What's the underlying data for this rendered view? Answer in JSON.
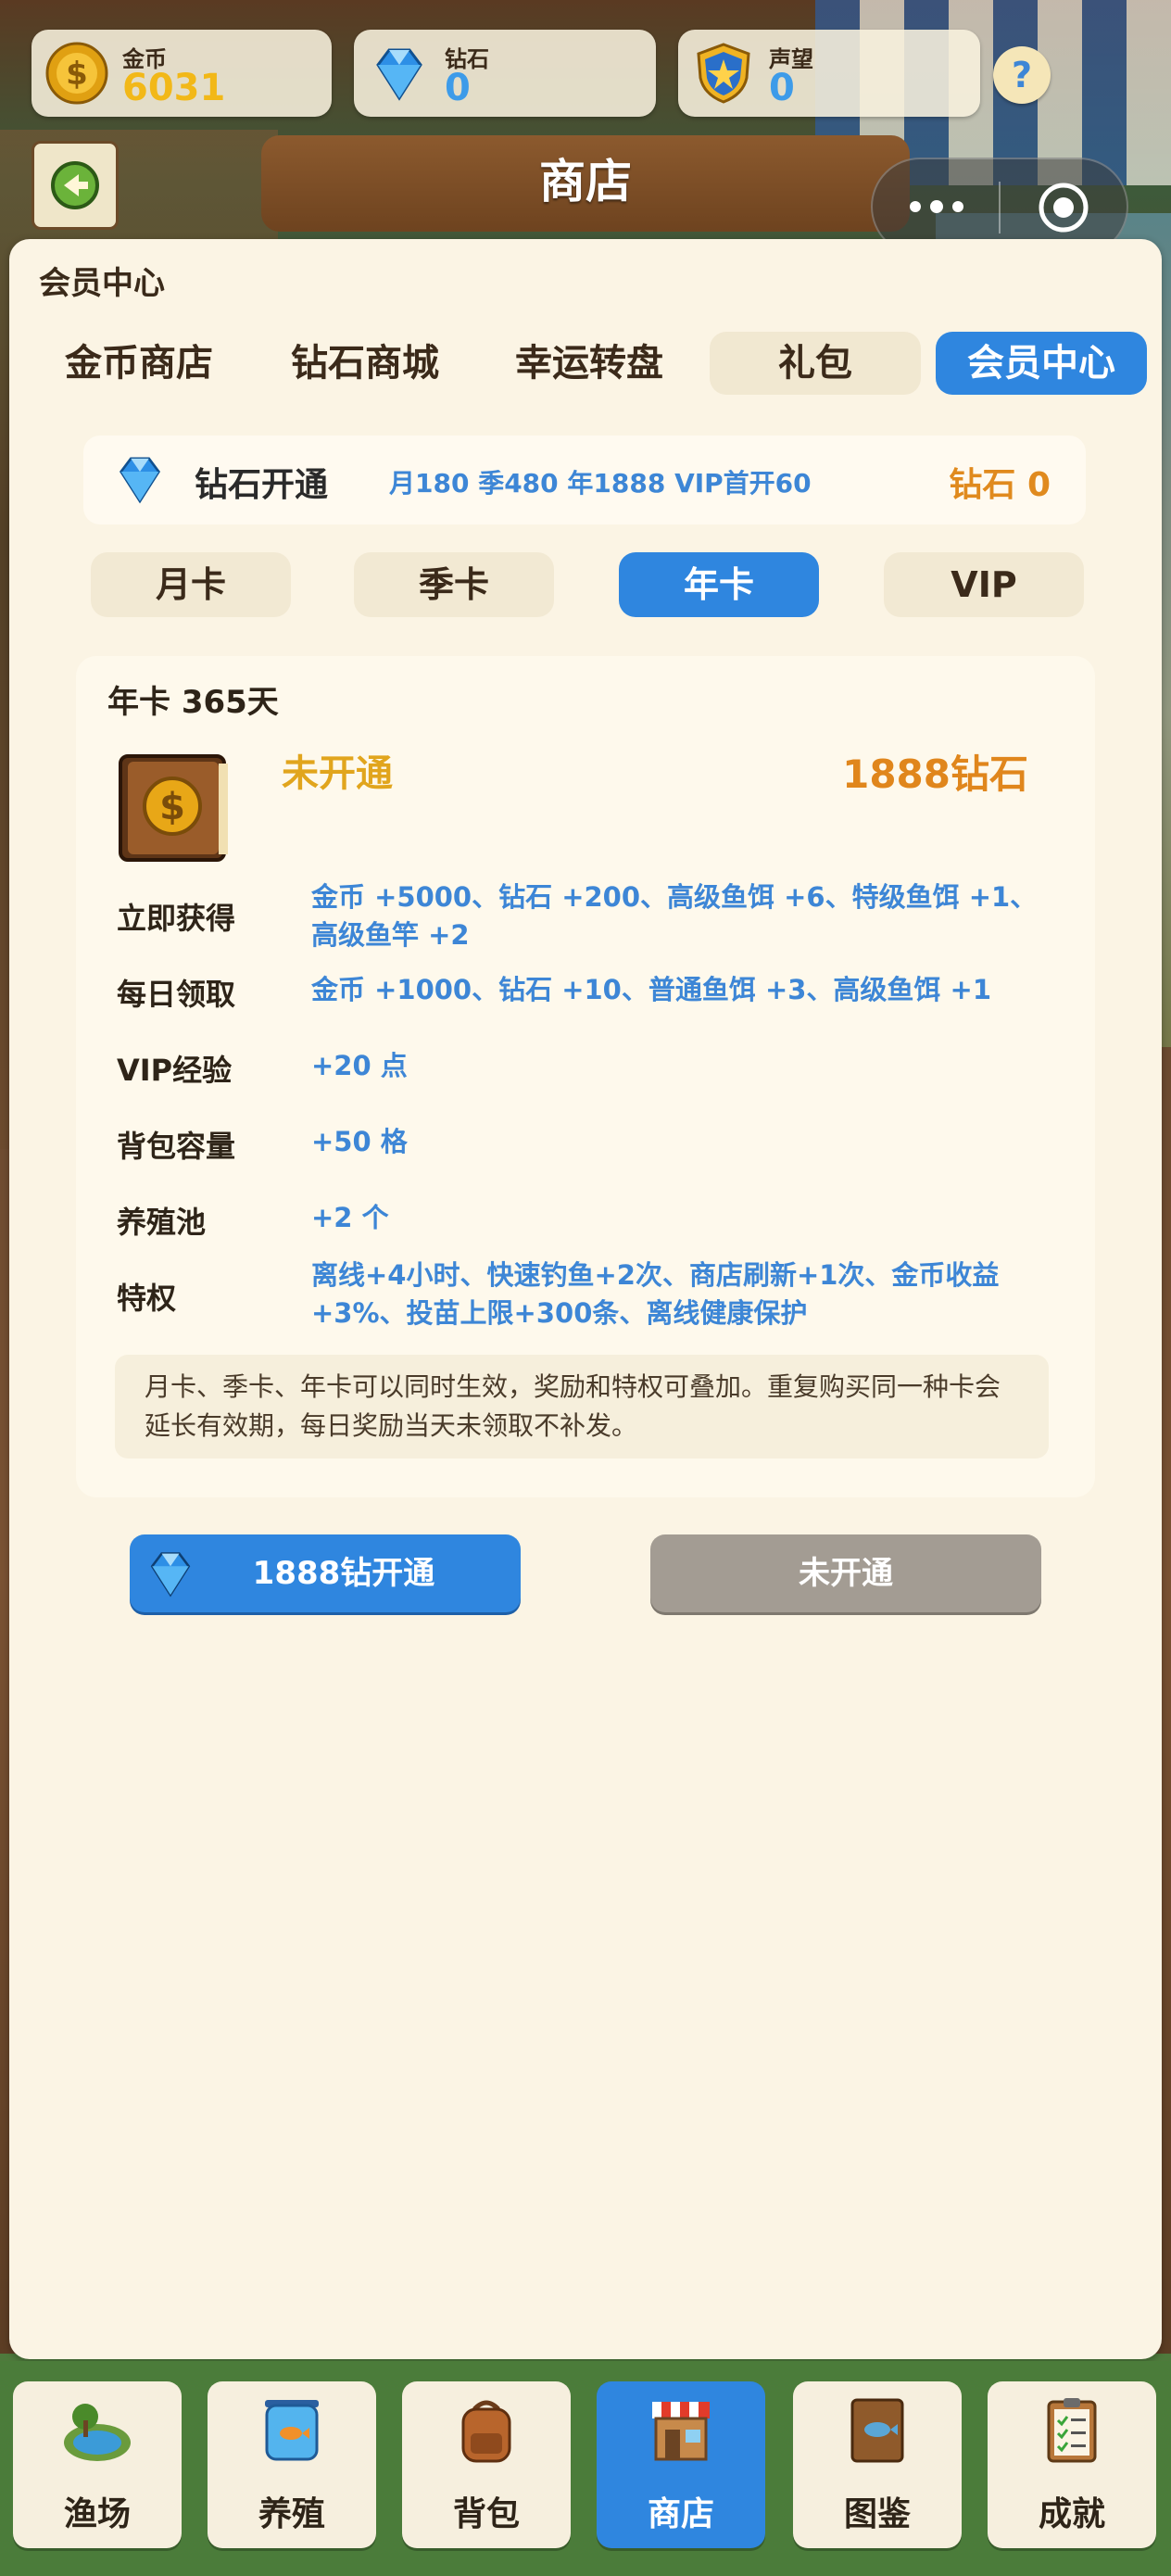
{
  "currencies": {
    "gold": {
      "label": "金币",
      "value": "6031",
      "color": "#f2b818"
    },
    "diamond": {
      "label": "钻石",
      "value": "0",
      "color": "#3d9be9"
    },
    "prestige": {
      "label": "声望",
      "value": "0",
      "color": "#3d9be9"
    }
  },
  "help_label": "?",
  "header": {
    "title": "商店"
  },
  "panel_title": "会员中心",
  "tabs": [
    "金币商店",
    "钻石商城",
    "幸运转盘",
    "礼包",
    "会员中心"
  ],
  "active_tab": "会员中心",
  "vip_bar": {
    "title": "钻石开通",
    "prices": "月180 季480 年1888 VIP首开60",
    "balance": "钻石 0"
  },
  "subtabs": [
    "月卡",
    "季卡",
    "年卡",
    "VIP"
  ],
  "active_subtab": "年卡",
  "card": {
    "title": "年卡 365天",
    "status": "未开通",
    "price": "1888钻石",
    "rows": [
      {
        "label": "立即获得",
        "value": "金币 +5000、钻石 +200、高级鱼饵 +6、特级鱼饵 +1、高级鱼竿 +2"
      },
      {
        "label": "每日领取",
        "value": "金币 +1000、钻石 +10、普通鱼饵 +3、高级鱼饵 +1"
      },
      {
        "label": "VIP经验",
        "value": "+20 点"
      },
      {
        "label": "背包容量",
        "value": "+50 格"
      },
      {
        "label": "养殖池",
        "value": "+2 个"
      },
      {
        "label": "特权",
        "value": "离线+4小时、快速钓鱼+2次、商店刷新+1次、金币收益+3%、投苗上限+300条、离线健康保护"
      }
    ],
    "note": "月卡、季卡、年卡可以同时生效，奖励和特权可叠加。重复购买同一种卡会延长有效期，每日奖励当天未领取不补发。"
  },
  "buy_button": "1888钻开通",
  "status_button": "未开通",
  "nav": [
    {
      "label": "渔场",
      "icon": "fishing-pond-icon"
    },
    {
      "label": "养殖",
      "icon": "fish-tank-icon"
    },
    {
      "label": "背包",
      "icon": "backpack-icon"
    },
    {
      "label": "商店",
      "icon": "shop-icon"
    },
    {
      "label": "图鉴",
      "icon": "fish-book-icon"
    },
    {
      "label": "成就",
      "icon": "clipboard-icon"
    }
  ],
  "active_nav": "商店",
  "colors": {
    "accent": "#2f86df",
    "panel": "#fbf4e4",
    "nav_bg": "#4b7c3a"
  }
}
